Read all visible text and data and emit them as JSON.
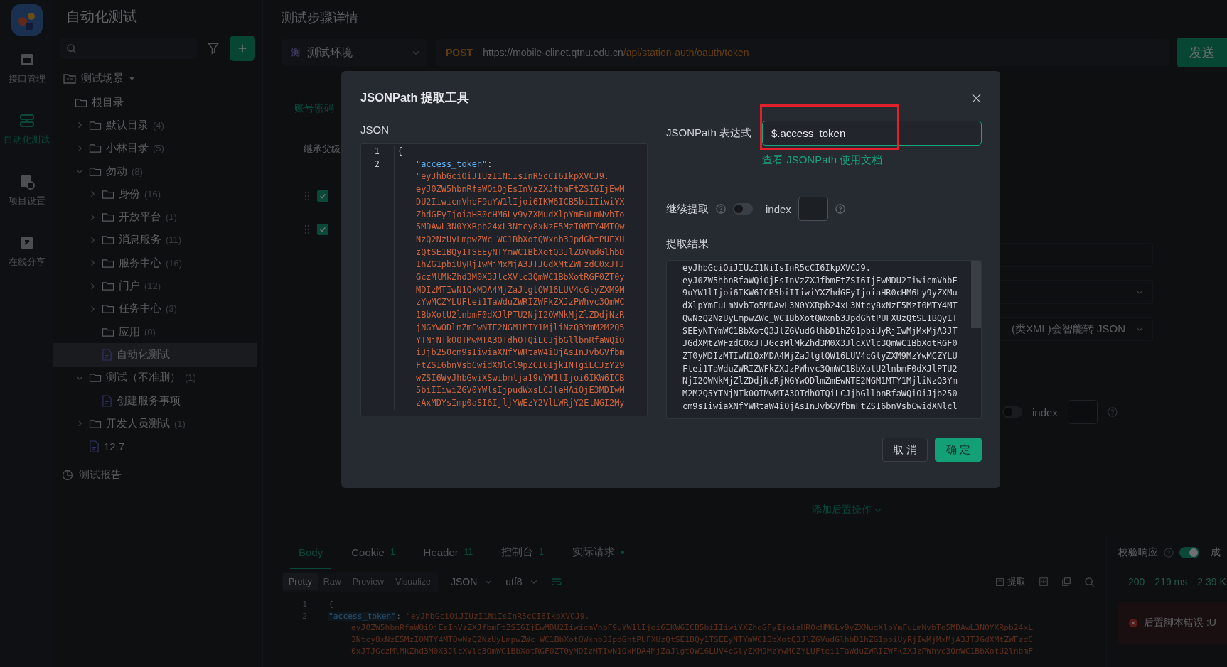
{
  "nav_rail": {
    "items": [
      {
        "label": "接口管理",
        "selected": false
      },
      {
        "label": "自动化测试",
        "selected": true
      },
      {
        "label": "项目设置",
        "selected": false
      },
      {
        "label": "在线分享",
        "selected": false
      }
    ]
  },
  "tree_panel": {
    "title": "自动化测试",
    "scene_label": "测试场景",
    "tree": [
      {
        "label": "根目录",
        "kind": "root",
        "selected": false,
        "children": [
          {
            "label": "默认目录",
            "count": "(4)",
            "kind": "folder",
            "expanded": false,
            "selected": false
          },
          {
            "label": "小林目录",
            "count": "(5)",
            "kind": "folder",
            "expanded": false,
            "selected": false
          },
          {
            "label": "勿动",
            "count": "(8)",
            "kind": "folder",
            "expanded": true,
            "selected": false,
            "children": [
              {
                "label": "身份",
                "count": "(16)",
                "kind": "folder",
                "expanded": false,
                "selected": false
              },
              {
                "label": "开放平台",
                "count": "(1)",
                "kind": "folder",
                "expanded": false,
                "selected": false
              },
              {
                "label": "消息服务",
                "count": "(11)",
                "kind": "folder",
                "expanded": false,
                "selected": false
              },
              {
                "label": "服务中心",
                "count": "(16)",
                "kind": "folder",
                "expanded": false,
                "selected": false
              },
              {
                "label": "门户",
                "count": "(12)",
                "kind": "folder",
                "expanded": false,
                "selected": false
              },
              {
                "label": "任务中心",
                "count": "(3)",
                "kind": "folder",
                "expanded": false,
                "selected": false
              },
              {
                "label": "应用",
                "count": "(0)",
                "kind": "empty-folder",
                "selected": false
              },
              {
                "label": "自动化测试",
                "kind": "file",
                "selected": true
              }
            ]
          },
          {
            "label": "测试（不准删）",
            "count": "(1)",
            "kind": "folder",
            "expanded": true,
            "selected": false,
            "children": [
              {
                "label": "创建服务事项",
                "kind": "file",
                "selected": false
              }
            ]
          },
          {
            "label": "开发人员测试",
            "count": "(1)",
            "kind": "folder",
            "expanded": false,
            "selected": false
          },
          {
            "label": "12.7",
            "kind": "file",
            "selected": false
          }
        ]
      }
    ],
    "report_label": "测试报告"
  },
  "step_detail": {
    "title": "测试步骤详情",
    "environment": {
      "badge": "测",
      "label": "测试环境"
    },
    "request": {
      "method": "POST",
      "url_host": "https://mobile-clinet.qtnu.edu.cn",
      "url_path": "/api/station-auth/oauth/token"
    },
    "send_button": "发送",
    "auth_link": "账号密码",
    "inherit_label": "继承父级",
    "steps": [
      {
        "checked": true
      },
      {
        "checked": true
      }
    ],
    "converter_value": "(类XML)会智能转 JSON",
    "continue_extract": {
      "on": false,
      "index_label": "index"
    },
    "add_post_action": "添加后置操作"
  },
  "response": {
    "tabs": [
      {
        "label": "Body",
        "selected": true,
        "dot": false
      },
      {
        "label": "Cookie",
        "count": "1",
        "selected": false,
        "dot": false
      },
      {
        "label": "Header",
        "count": "11",
        "selected": false,
        "dot": false
      },
      {
        "label": "控制台",
        "count": "1",
        "selected": false,
        "dot": false
      },
      {
        "label": "实际请求",
        "selected": false,
        "dot": true
      }
    ],
    "view_modes": [
      {
        "label": "Pretty",
        "selected": true
      },
      {
        "label": "Raw",
        "selected": false
      },
      {
        "label": "Preview",
        "selected": false
      },
      {
        "label": "Visualize",
        "selected": false
      }
    ],
    "format": "JSON",
    "encoding": "utf8",
    "extract_button": "提取",
    "code": [
      {
        "number": "1",
        "text": "{"
      },
      {
        "number": "2",
        "key": "\"access_token\"",
        "punct": ": ",
        "value": [
          "\"eyJhbGciOiJIUzI1NiIsInR5cCI6IkpXVCJ9.",
          "eyJ0ZW5hbnRfaWQiOjEsInVzZXJfbmFtZSI6IjEwMDU2IiwicmVhbF9uYW1lIjoi6IKW6ICB5biIIiwiYXZhdGFyIjoiaHR0cHM6Ly9yZXMudXlpYmFuLmNvbTo5MDAwL3N0YXRpb24xL",
          "3Ntcy8xNzE5MzI0MTY4MTQwNzQ2NzUyLmpwZWc_WC1BbXotQWxnb3JpdGhtPUFXUzQtSE1BQy1TSEEyNTYmWC1BbXotQ3JlZGVudGlhbD1hZG1pbiUyRjIwMjMxMjA3JTJGdXMtZWFzdC",
          "0xJTJGczMlMkZhd3M0X3JlcXVlc3QmWC1BbXotRGF0ZT0yMDIzMTIwN1QxMDA4MjZaJlgtQW16LUV4cGlyZXM9MzYwMCZYLUFtei1TaWduZWRIZWFkZXJzPWhvc3QmWC1BbXotU2lnbmF"
        ]
      }
    ],
    "validation": {
      "label": "校验响应",
      "on": true,
      "cut_label": "成"
    },
    "stats": {
      "status": "200",
      "time": "219 ms",
      "size": "2.39 K"
    },
    "error_text": "后置脚本错误 :U"
  },
  "dialog": {
    "title": "JSONPath 提取工具",
    "json_label": "JSON",
    "json_lines": [
      {
        "number": "1",
        "text": "{"
      },
      {
        "number": "2",
        "key": "\"access_token\"",
        "punct": ":",
        "value": [
          "\"eyJhbGciOiJIUzI1NiIsInR5cCI6IkpXVCJ9.",
          "eyJ0ZW5hbnRfaWQiOjEsInVzZXJfbmFtZSI6IjEwM",
          "DU2IiwicmVhbF9uYW1lIjoi6IKW6ICB5biIIiwiYX",
          "ZhdGFyIjoiaHR0cHM6Ly9yZXMudXlpYmFuLmNvbTo",
          "5MDAwL3N0YXRpb24xL3Ntcy8xNzE5MzI0MTY4MTQw",
          "NzQ2NzUyLmpwZWc_WC1BbXotQWxnb3JpdGhtPUFXU",
          "zQtSE1BQy1TSEEyNTYmWC1BbXotQ3JlZGVudGlhbD",
          "1hZG1pbiUyRjIwMjMxMjA3JTJGdXMtZWFzdC0xJTJ",
          "GczMlMkZhd3M0X3JlcXVlc3QmWC1BbXotRGF0ZT0y",
          "MDIzMTIwN1QxMDA4MjZaJlgtQW16LUV4cGlyZXM9M",
          "zYwMCZYLUFtei1TaWduZWRIZWFkZXJzPWhvc3QmWC",
          "1BbXotU2lnbmF0dXJlPTU2NjI2OWNkMjZlZDdjNzR",
          "jNGYwODlmZmEwNTE2NGM1MTY1MjliNzQ3YmM2M2Q5",
          "YTNjNTk0OTMwMTA3OTdhOTQiLCJjbGllbnRfaWQiO",
          "iJjb250cm9sIiwiaXNfYWRtaW4iOjAsInJvbGVfbm",
          "FtZSI6bnVsbCwidXNlcl9pZCI6Ijk1NTgiLCJzY29",
          "wZSI6WyJhbGwiXSwibmlja19uYW1lIjoi6IKW6ICB",
          "5biIIiwiZGV0YWlsIjpudWxsLCJleHAiOjE3MDIwM",
          "zAxMDYsImp0aSI6IjljYWEzY2VlLWRjY2EtNGI2My"
        ]
      }
    ],
    "expression_label": "JSONPath 表达式",
    "expression_value": "$.access_token",
    "annotation_box": true,
    "doc_link": "查看 JSONPath 使用文档",
    "continue_label": "继续提取",
    "continue_on": false,
    "index_label": "index",
    "result_label": "提取结果",
    "result_lines": [
      "eyJhbGciOiJIUzI1NiIsInR5cCI6IkpXVCJ9.",
      "eyJ0ZW5hbnRfaWQiOjEsInVzZXJfbmFtZSI6IjEwMDU2IiwicmVhbF",
      "9uYW1lIjoi6IKW6ICB5biIIiwiYXZhdGFyIjoiaHR0cHM6Ly9yZXMu",
      "dXlpYmFuLmNvbTo5MDAwL3N0YXRpb24xL3Ntcy8xNzE5MzI0MTY4MT",
      "QwNzQ2NzUyLmpwZWc_WC1BbXotQWxnb3JpdGhtPUFXUzQtSE1BQy1T",
      "SEEyNTYmWC1BbXotQ3JlZGVudGlhbD1hZG1pbiUyRjIwMjMxMjA3JT",
      "JGdXMtZWFzdC0xJTJGczMlMkZhd3M0X3JlcXVlc3QmWC1BbXotRGF0",
      "ZT0yMDIzMTIwN1QxMDA4MjZaJlgtQW16LUV4cGlyZXM9MzYwMCZYLU",
      "Ftei1TaWduZWRIZWFkZXJzPWhvc3QmWC1BbXotU2lnbmF0dXJlPTU2",
      "NjI2OWNkMjZlZDdjNzRjNGYwODlmZmEwNTE2NGM1MTY1MjliNzQ3Ym",
      "M2M2Q5YTNjNTk0OTMwMTA3OTdhOTQiLCJjbGllbnRfaWQiOiJjb250",
      "cm9sIiwiaXNfYWRtaW4iOjAsInJvbGVfbmFtZSI6bnVsbCwidXNlcl"
    ],
    "cancel_button": "取 消",
    "ok_button": "确 定"
  }
}
